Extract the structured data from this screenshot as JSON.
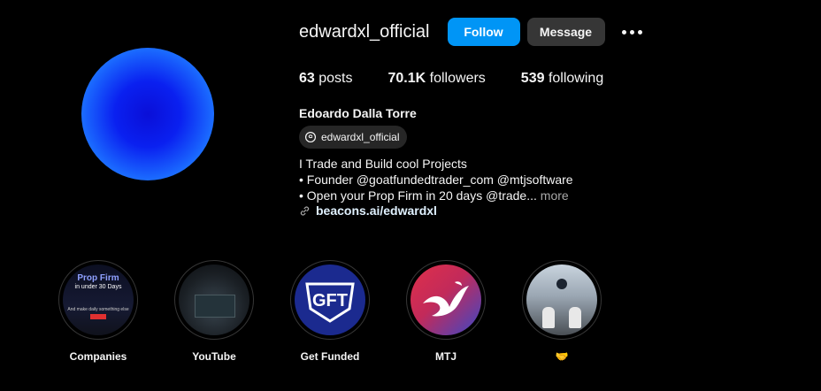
{
  "profile": {
    "username": "edwardxl_official",
    "follow_label": "Follow",
    "message_label": "Message",
    "stats": {
      "posts_count": "63",
      "posts_label": "posts",
      "followers_count": "70.1K",
      "followers_label": "followers",
      "following_count": "539",
      "following_label": "following"
    },
    "full_name": "Edoardo Dalla Torre",
    "threads_handle": "edwardxl_official",
    "bio": {
      "line1": "I Trade and Build cool Projects",
      "line2": "• Founder @goatfundedtrader_com @mtjsoftware",
      "line3": "• Open your Prop Firm in 20 days @trade...",
      "more_label": "more"
    },
    "link": "beacons.ai/edwardxl"
  },
  "highlights": [
    {
      "label": "Companies",
      "thumb_title": "Prop Firm",
      "thumb_sub": "in under 30 Days",
      "thumb_mid": "And make daily something else"
    },
    {
      "label": "YouTube"
    },
    {
      "label": "Get Funded",
      "logo_text": "GFT"
    },
    {
      "label": "MTJ"
    },
    {
      "label": "🤝"
    }
  ],
  "colors": {
    "follow_button": "#0095f6",
    "message_button": "#363636",
    "background": "#000000"
  }
}
